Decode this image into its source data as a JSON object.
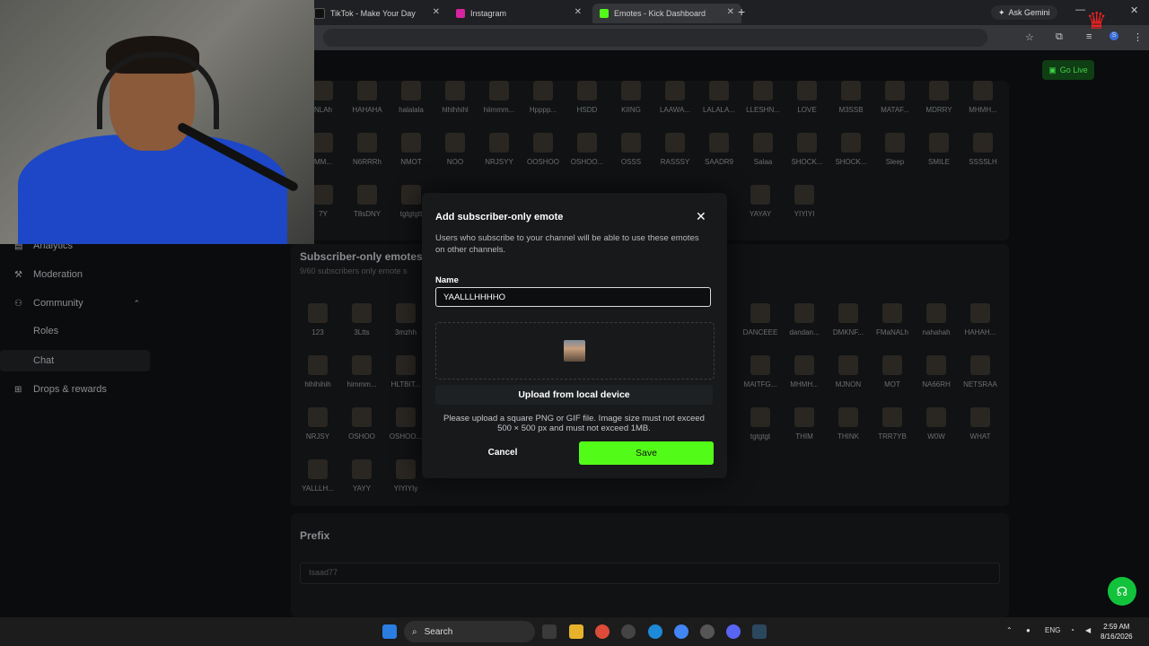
{
  "browser": {
    "tabs": [
      {
        "title": "TikTok - Make Your Day",
        "color": "#111111"
      },
      {
        "title": "Instagram",
        "color": "#d6249f"
      },
      {
        "title": "Emotes - Kick Dashboard",
        "color": "#53fc18",
        "active": true
      }
    ],
    "ask_gemini": "Ask Gemini"
  },
  "header": {
    "go_live": "Go Live"
  },
  "sidebar": {
    "items": [
      {
        "label": "Analytics",
        "icon": "chart-icon"
      },
      {
        "label": "Moderation",
        "icon": "wrench-icon"
      },
      {
        "label": "Community",
        "icon": "people-icon"
      },
      {
        "label": "Roles"
      },
      {
        "label": "Chat"
      },
      {
        "label": "Drops & rewards",
        "icon": "gift-icon"
      }
    ]
  },
  "emotes_top": {
    "row1": [
      "NLAh",
      "HAHAHA",
      "halalala",
      "hlhlhhihl",
      "hiimmm...",
      "Hpppp...",
      "HSDD",
      "KIING",
      "LAAWA...",
      "LALALA...",
      "LLESHN...",
      "LOVE",
      "M3SSB",
      "MATAF...",
      "MDRRY",
      "MHMH..."
    ],
    "row2": [
      "MM...",
      "N6RRRh",
      "NMOT",
      "NOO",
      "NRJSYY",
      "OOSHOO",
      "OSHOO...",
      "OSSS",
      "RASSSY",
      "SAADR9",
      "Salaa",
      "SHOCK...",
      "SHOCK...",
      "Sleep",
      "SMILE",
      "SSSSLH"
    ],
    "row3": [
      "7Y",
      "T8sDNY",
      "tgtgtgtt",
      "YAYAY",
      "YIYIYI"
    ]
  },
  "subscriber_section": {
    "title": "Subscriber-only emotes",
    "subtitle": "9/60 subscribers only emote s",
    "left_row1": [
      "123",
      "3Ltts",
      "3mzhh"
    ],
    "left_row2": [
      "hlhlhihih",
      "himmm...",
      "HLTBIT..."
    ],
    "left_row3": [
      "NRJSY",
      "OSHOO",
      "OSHOO..."
    ],
    "left_row4": [
      "YALLLH...",
      "YAYY",
      "YIYIYIy"
    ],
    "right_row1": [
      "DANCEEE",
      "dandan...",
      "DMKNF...",
      "FMaNALh",
      "nahahah",
      "HAHAH..."
    ],
    "right_row2": [
      "MAITFG...",
      "MHMH...",
      "MJNON",
      "MOT",
      "NA66RH",
      "NETSRAA"
    ],
    "right_row3": [
      "tgtgtgt",
      "THIM",
      "THINK",
      "TRR7YB",
      "W0W",
      "WHAT"
    ]
  },
  "prefix": {
    "title": "Prefix",
    "value": "Isaad77"
  },
  "modal": {
    "title": "Add subscriber-only emote",
    "description": "Users who subscribe to your channel will be able to use these emotes on other channels.",
    "name_label": "Name",
    "name_value": "YAALLLHHHHO",
    "upload_label": "Upload from local device",
    "note": "Please upload a square PNG or GIF file. Image size must not exceed 500 × 500 px and must not exceed 1MB.",
    "cancel": "Cancel",
    "save": "Save"
  },
  "taskbar": {
    "search": "Search",
    "lang": "ENG",
    "time": "2:59 AM",
    "date": "8/16/2026"
  },
  "colors": {
    "accent": "#53fc18",
    "support": "#13c23b"
  }
}
